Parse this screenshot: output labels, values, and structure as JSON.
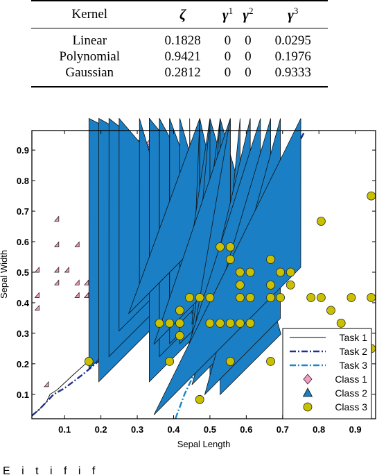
{
  "table": {
    "headers": [
      "Kernel",
      "ζ",
      "γ",
      "γ",
      "γ"
    ],
    "header_superscripts": [
      "",
      "",
      "1",
      "2",
      "3"
    ],
    "rows": [
      [
        "Linear",
        "0.1828",
        "0",
        "0",
        "0.0295"
      ],
      [
        "Polynomial",
        "0.9421",
        "0",
        "0",
        "0.1976"
      ],
      [
        "Gaussian",
        "0.2812",
        "0",
        "0",
        "0.9333"
      ]
    ]
  },
  "chart_data": {
    "type": "scatter",
    "title": "",
    "xlabel": "Sepal Length",
    "ylabel": "Sepal Width",
    "xlim": [
      0.01,
      0.956
    ],
    "ylim": [
      0.02,
      0.964
    ],
    "xticks": [
      0.1,
      0.2,
      0.3,
      0.4,
      0.5,
      0.6,
      0.7,
      0.8,
      0.9
    ],
    "yticks": [
      0.1,
      0.2,
      0.3,
      0.4,
      0.5,
      0.6,
      0.7,
      0.8,
      0.9
    ],
    "xtick_labels": [
      "0.1",
      "0.2",
      "0.3",
      "0.4",
      "0.5",
      "0.6",
      "0.7",
      "0.8",
      "0.9"
    ],
    "ytick_labels": [
      "0.1",
      "0.2",
      "0.3",
      "0.4",
      "0.5",
      "0.6",
      "0.7",
      "0.8",
      "0.9"
    ],
    "grid": false,
    "legend_position": "bottom-right",
    "lines": [
      {
        "name": "Task 1",
        "style": "solid",
        "color": "#000000",
        "x": [
          0.01,
          0.03,
          0.05,
          0.06,
          0.08,
          0.12,
          0.2,
          0.26,
          0.32,
          0.4,
          0.5,
          0.62
        ],
        "y": [
          0.03,
          0.05,
          0.075,
          0.1,
          0.115,
          0.16,
          0.245,
          0.31,
          0.38,
          0.47,
          0.595,
          0.76
        ]
      },
      {
        "name": "Task 2",
        "style": "dash-dot",
        "color": "#1f2f8f",
        "x": [
          0.01,
          0.03,
          0.05,
          0.07,
          0.1,
          0.15,
          0.2,
          0.3,
          0.4,
          0.5,
          0.6,
          0.7,
          0.76
        ],
        "y": [
          0.03,
          0.05,
          0.075,
          0.1,
          0.12,
          0.165,
          0.215,
          0.325,
          0.44,
          0.55,
          0.675,
          0.82,
          0.96
        ]
      },
      {
        "name": "Task 3",
        "style": "dash-dot",
        "color": "#1a86c8",
        "x": [
          0.405,
          0.43,
          0.47,
          0.5,
          0.52,
          0.535,
          0.54,
          0.545,
          0.548,
          0.546,
          0.54,
          0.53
        ],
        "y": [
          0.02,
          0.1,
          0.2,
          0.28,
          0.35,
          0.42,
          0.5,
          0.6,
          0.7,
          0.8,
          0.9,
          0.96
        ]
      }
    ],
    "series": [
      {
        "name": "Class 1",
        "marker": "diamond",
        "color": "#f59ac2",
        "points": [
          [
            0.03,
            0.5
          ],
          [
            0.03,
            0.417
          ],
          [
            0.03,
            0.375
          ],
          [
            0.084,
            0.667
          ],
          [
            0.084,
            0.583
          ],
          [
            0.084,
            0.5
          ],
          [
            0.084,
            0.458
          ],
          [
            0.112,
            0.5
          ],
          [
            0.14,
            0.583
          ],
          [
            0.14,
            0.458
          ],
          [
            0.166,
            0.458
          ],
          [
            0.166,
            0.417
          ],
          [
            0.14,
            0.417
          ],
          [
            0.194,
            0.667
          ],
          [
            0.194,
            0.625
          ],
          [
            0.194,
            0.583
          ],
          [
            0.194,
            0.542
          ],
          [
            0.194,
            0.5
          ],
          [
            0.194,
            0.417
          ],
          [
            0.194,
            0.458
          ],
          [
            0.222,
            0.75
          ],
          [
            0.222,
            0.708
          ],
          [
            0.222,
            0.625
          ],
          [
            0.222,
            0.583
          ],
          [
            0.222,
            0.542
          ],
          [
            0.25,
            0.875
          ],
          [
            0.25,
            0.625
          ],
          [
            0.25,
            0.583
          ],
          [
            0.278,
            0.708
          ],
          [
            0.306,
            0.792
          ],
          [
            0.306,
            0.708
          ],
          [
            0.306,
            0.583
          ],
          [
            0.333,
            0.917
          ],
          [
            0.333,
            0.625
          ],
          [
            0.389,
            0.75
          ],
          [
            0.417,
            0.833
          ],
          [
            0.056,
            0.125
          ]
        ]
      },
      {
        "name": "Class 2",
        "marker": "triangle",
        "color": "#1a7fc4",
        "points": [
          [
            0.167,
            0.167
          ],
          [
            0.194,
            0.125
          ],
          [
            0.222,
            0.208
          ],
          [
            0.25,
            0.292
          ],
          [
            0.306,
            0.417
          ],
          [
            0.333,
            0.25
          ],
          [
            0.333,
            0.208
          ],
          [
            0.333,
            0.167
          ],
          [
            0.333,
            0.125
          ],
          [
            0.361,
            0.375
          ],
          [
            0.361,
            0.333
          ],
          [
            0.361,
            0.292
          ],
          [
            0.361,
            0.25
          ],
          [
            0.361,
            0.208
          ],
          [
            0.389,
            0.417
          ],
          [
            0.389,
            0.375
          ],
          [
            0.389,
            0.25
          ],
          [
            0.417,
            0.375
          ],
          [
            0.417,
            0.333
          ],
          [
            0.417,
            0.25
          ],
          [
            0.444,
            0.375
          ],
          [
            0.472,
            0.583
          ],
          [
            0.472,
            0.375
          ],
          [
            0.472,
            0.292
          ],
          [
            0.472,
            0.25
          ],
          [
            0.472,
            0.208
          ],
          [
            0.5,
            0.417
          ],
          [
            0.5,
            0.375
          ],
          [
            0.5,
            0.125
          ],
          [
            0.528,
            0.375
          ],
          [
            0.528,
            0.333
          ],
          [
            0.528,
            0.083
          ],
          [
            0.556,
            0.5
          ],
          [
            0.556,
            0.375
          ],
          [
            0.583,
            0.292
          ],
          [
            0.611,
            0.375
          ],
          [
            0.639,
            0.417
          ],
          [
            0.667,
            0.375
          ],
          [
            0.694,
            0.333
          ],
          [
            0.75,
            0.5
          ]
        ]
      },
      {
        "name": "Class 3",
        "marker": "circle",
        "color": "#c8c000",
        "points": [
          [
            0.167,
            0.208
          ],
          [
            0.361,
            0.333
          ],
          [
            0.389,
            0.208
          ],
          [
            0.389,
            0.333
          ],
          [
            0.417,
            0.375
          ],
          [
            0.417,
            0.292
          ],
          [
            0.417,
            0.333
          ],
          [
            0.444,
            0.417
          ],
          [
            0.472,
            0.417
          ],
          [
            0.472,
            0.083
          ],
          [
            0.5,
            0.417
          ],
          [
            0.5,
            0.333
          ],
          [
            0.528,
            0.583
          ],
          [
            0.528,
            0.333
          ],
          [
            0.556,
            0.583
          ],
          [
            0.556,
            0.542
          ],
          [
            0.556,
            0.333
          ],
          [
            0.556,
            0.208
          ],
          [
            0.583,
            0.5
          ],
          [
            0.583,
            0.458
          ],
          [
            0.583,
            0.417
          ],
          [
            0.583,
            0.333
          ],
          [
            0.611,
            0.5
          ],
          [
            0.611,
            0.417
          ],
          [
            0.611,
            0.333
          ],
          [
            0.667,
            0.542
          ],
          [
            0.667,
            0.458
          ],
          [
            0.667,
            0.417
          ],
          [
            0.667,
            0.208
          ],
          [
            0.694,
            0.5
          ],
          [
            0.694,
            0.417
          ],
          [
            0.722,
            0.458
          ],
          [
            0.722,
            0.5
          ],
          [
            0.778,
            0.417
          ],
          [
            0.806,
            0.667
          ],
          [
            0.806,
            0.417
          ],
          [
            0.833,
            0.375
          ],
          [
            0.861,
            0.333
          ],
          [
            0.889,
            0.417
          ],
          [
            0.944,
            0.75
          ],
          [
            0.944,
            0.417
          ],
          [
            0.944,
            0.25
          ],
          [
            0.778,
            0.208
          ]
        ]
      }
    ]
  },
  "caption_fragment": "E i    t   i   f  i  f    "
}
